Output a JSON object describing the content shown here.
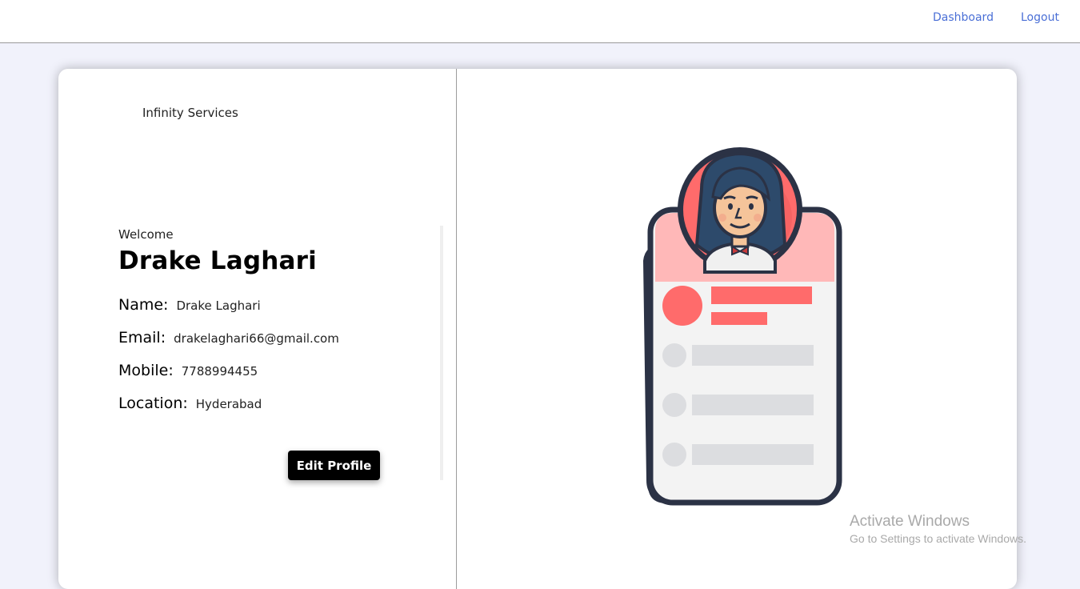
{
  "nav": {
    "dashboard_label": "Dashboard",
    "logout_label": "Logout"
  },
  "sidebar": {
    "brand": "Infinity Services"
  },
  "profile": {
    "welcome": "Welcome",
    "display_name": "Drake Laghari",
    "fields": {
      "name_label": "Name:",
      "name_value": "Drake Laghari",
      "email_label": "Email:",
      "email_value": "drakelaghari66@gmail.com",
      "mobile_label": "Mobile:",
      "mobile_value": "7788994455",
      "location_label": "Location:",
      "location_value": "Hyderabad"
    },
    "edit_button_label": "Edit Profile"
  },
  "illustration": {
    "icon": "profile-card-illustration",
    "colors": {
      "accent": "#ff6b6b",
      "header_pink": "#ffb8b8",
      "outline": "#2b3245",
      "placeholder": "#dcdde0",
      "card_bg": "#f3f3f3"
    }
  },
  "watermark": {
    "title": "Activate Windows",
    "subtitle": "Go to Settings to activate Windows."
  },
  "colors": {
    "link": "#4a6fd6",
    "page_bg": "#f1f2fb",
    "button_bg": "#000000"
  }
}
